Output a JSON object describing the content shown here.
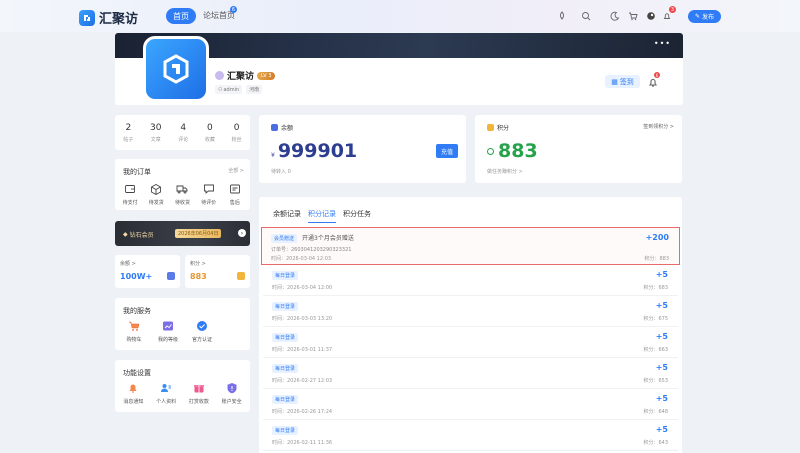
{
  "nav": {
    "logo_text": "汇聚访",
    "home": "首页",
    "forum": "论坛首页",
    "forum_badge": "6",
    "notif_count": "3",
    "post_btn": "发布"
  },
  "profile": {
    "name": "汇聚访",
    "level": "LV 3",
    "role": "admin",
    "location": "河南",
    "checkin": "签到",
    "bell_count": "6"
  },
  "stats": [
    {
      "num": "2",
      "label": "帖子"
    },
    {
      "num": "30",
      "label": "文章"
    },
    {
      "num": "4",
      "label": "评论"
    },
    {
      "num": "0",
      "label": "收藏"
    },
    {
      "num": "0",
      "label": "粉丝"
    }
  ],
  "orders": {
    "title": "我的订单",
    "more": "全部 >",
    "items": [
      "待支付",
      "待发货",
      "待收货",
      "待评价",
      "售后"
    ]
  },
  "vip": {
    "title": "钻石会员",
    "date": "2026年06月04日"
  },
  "mini": {
    "balance_label": "余额 >",
    "balance_value": "100W+",
    "points_label": "积分 >",
    "points_value": "883"
  },
  "services": {
    "title": "我的服务",
    "items": [
      "购物车",
      "我的等级",
      "官方认证"
    ]
  },
  "settings": {
    "title": "功能设置",
    "items": [
      "消息通知",
      "个人资料",
      "打赏收款",
      "账户安全"
    ]
  },
  "balance": {
    "title": "余额",
    "currency": "¥",
    "value": "999901",
    "recharge": "充值",
    "sub": "待转入 0"
  },
  "points": {
    "title": "积分",
    "more": "签到领积分 >",
    "value": "883",
    "sub": "做任务赚积分 >"
  },
  "records": {
    "tabs": [
      "余额记录",
      "积分记录",
      "积分任务"
    ],
    "highlight": {
      "badge": "会员赠送",
      "desc": "开通3个月会员赠送",
      "amount": "+200",
      "order": "订单号：2603041203290323321",
      "time": "时间：2026-03-04 12:03",
      "total": "积分：883"
    },
    "items": [
      {
        "badge": "每日登录",
        "amount": "+5",
        "time": "时间：2026-03-04 12:00",
        "total": "积分：683"
      },
      {
        "badge": "每日登录",
        "amount": "+5",
        "time": "时间：2026-03-03 13:20",
        "total": "积分：675"
      },
      {
        "badge": "每日登录",
        "amount": "+5",
        "time": "时间：2026-03-01 11:37",
        "total": "积分：663"
      },
      {
        "badge": "每日登录",
        "amount": "+5",
        "time": "时间：2026-02-27 12:03",
        "total": "积分：653"
      },
      {
        "badge": "每日登录",
        "amount": "+5",
        "time": "时间：2026-02-26 17:24",
        "total": "积分：648"
      },
      {
        "badge": "每日登录",
        "amount": "+5",
        "time": "时间：2026-02-11 11:36",
        "total": "积分：643"
      }
    ]
  }
}
